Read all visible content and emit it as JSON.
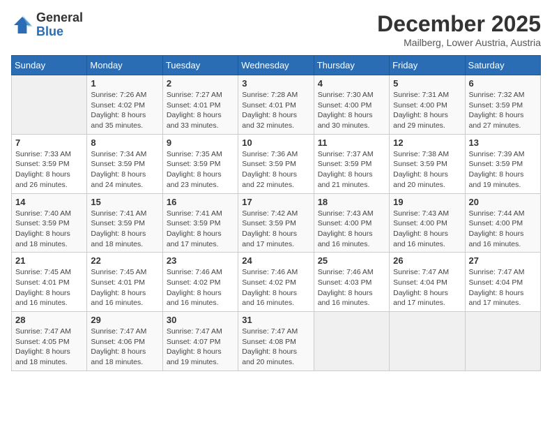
{
  "header": {
    "logo_general": "General",
    "logo_blue": "Blue",
    "month_title": "December 2025",
    "location": "Mailberg, Lower Austria, Austria"
  },
  "weekdays": [
    "Sunday",
    "Monday",
    "Tuesday",
    "Wednesday",
    "Thursday",
    "Friday",
    "Saturday"
  ],
  "weeks": [
    [
      {
        "day": "",
        "sunrise": "",
        "sunset": "",
        "daylight": ""
      },
      {
        "day": "1",
        "sunrise": "Sunrise: 7:26 AM",
        "sunset": "Sunset: 4:02 PM",
        "daylight": "Daylight: 8 hours and 35 minutes."
      },
      {
        "day": "2",
        "sunrise": "Sunrise: 7:27 AM",
        "sunset": "Sunset: 4:01 PM",
        "daylight": "Daylight: 8 hours and 33 minutes."
      },
      {
        "day": "3",
        "sunrise": "Sunrise: 7:28 AM",
        "sunset": "Sunset: 4:01 PM",
        "daylight": "Daylight: 8 hours and 32 minutes."
      },
      {
        "day": "4",
        "sunrise": "Sunrise: 7:30 AM",
        "sunset": "Sunset: 4:00 PM",
        "daylight": "Daylight: 8 hours and 30 minutes."
      },
      {
        "day": "5",
        "sunrise": "Sunrise: 7:31 AM",
        "sunset": "Sunset: 4:00 PM",
        "daylight": "Daylight: 8 hours and 29 minutes."
      },
      {
        "day": "6",
        "sunrise": "Sunrise: 7:32 AM",
        "sunset": "Sunset: 3:59 PM",
        "daylight": "Daylight: 8 hours and 27 minutes."
      }
    ],
    [
      {
        "day": "7",
        "sunrise": "Sunrise: 7:33 AM",
        "sunset": "Sunset: 3:59 PM",
        "daylight": "Daylight: 8 hours and 26 minutes."
      },
      {
        "day": "8",
        "sunrise": "Sunrise: 7:34 AM",
        "sunset": "Sunset: 3:59 PM",
        "daylight": "Daylight: 8 hours and 24 minutes."
      },
      {
        "day": "9",
        "sunrise": "Sunrise: 7:35 AM",
        "sunset": "Sunset: 3:59 PM",
        "daylight": "Daylight: 8 hours and 23 minutes."
      },
      {
        "day": "10",
        "sunrise": "Sunrise: 7:36 AM",
        "sunset": "Sunset: 3:59 PM",
        "daylight": "Daylight: 8 hours and 22 minutes."
      },
      {
        "day": "11",
        "sunrise": "Sunrise: 7:37 AM",
        "sunset": "Sunset: 3:59 PM",
        "daylight": "Daylight: 8 hours and 21 minutes."
      },
      {
        "day": "12",
        "sunrise": "Sunrise: 7:38 AM",
        "sunset": "Sunset: 3:59 PM",
        "daylight": "Daylight: 8 hours and 20 minutes."
      },
      {
        "day": "13",
        "sunrise": "Sunrise: 7:39 AM",
        "sunset": "Sunset: 3:59 PM",
        "daylight": "Daylight: 8 hours and 19 minutes."
      }
    ],
    [
      {
        "day": "14",
        "sunrise": "Sunrise: 7:40 AM",
        "sunset": "Sunset: 3:59 PM",
        "daylight": "Daylight: 8 hours and 18 minutes."
      },
      {
        "day": "15",
        "sunrise": "Sunrise: 7:41 AM",
        "sunset": "Sunset: 3:59 PM",
        "daylight": "Daylight: 8 hours and 18 minutes."
      },
      {
        "day": "16",
        "sunrise": "Sunrise: 7:41 AM",
        "sunset": "Sunset: 3:59 PM",
        "daylight": "Daylight: 8 hours and 17 minutes."
      },
      {
        "day": "17",
        "sunrise": "Sunrise: 7:42 AM",
        "sunset": "Sunset: 3:59 PM",
        "daylight": "Daylight: 8 hours and 17 minutes."
      },
      {
        "day": "18",
        "sunrise": "Sunrise: 7:43 AM",
        "sunset": "Sunset: 4:00 PM",
        "daylight": "Daylight: 8 hours and 16 minutes."
      },
      {
        "day": "19",
        "sunrise": "Sunrise: 7:43 AM",
        "sunset": "Sunset: 4:00 PM",
        "daylight": "Daylight: 8 hours and 16 minutes."
      },
      {
        "day": "20",
        "sunrise": "Sunrise: 7:44 AM",
        "sunset": "Sunset: 4:00 PM",
        "daylight": "Daylight: 8 hours and 16 minutes."
      }
    ],
    [
      {
        "day": "21",
        "sunrise": "Sunrise: 7:45 AM",
        "sunset": "Sunset: 4:01 PM",
        "daylight": "Daylight: 8 hours and 16 minutes."
      },
      {
        "day": "22",
        "sunrise": "Sunrise: 7:45 AM",
        "sunset": "Sunset: 4:01 PM",
        "daylight": "Daylight: 8 hours and 16 minutes."
      },
      {
        "day": "23",
        "sunrise": "Sunrise: 7:46 AM",
        "sunset": "Sunset: 4:02 PM",
        "daylight": "Daylight: 8 hours and 16 minutes."
      },
      {
        "day": "24",
        "sunrise": "Sunrise: 7:46 AM",
        "sunset": "Sunset: 4:02 PM",
        "daylight": "Daylight: 8 hours and 16 minutes."
      },
      {
        "day": "25",
        "sunrise": "Sunrise: 7:46 AM",
        "sunset": "Sunset: 4:03 PM",
        "daylight": "Daylight: 8 hours and 16 minutes."
      },
      {
        "day": "26",
        "sunrise": "Sunrise: 7:47 AM",
        "sunset": "Sunset: 4:04 PM",
        "daylight": "Daylight: 8 hours and 17 minutes."
      },
      {
        "day": "27",
        "sunrise": "Sunrise: 7:47 AM",
        "sunset": "Sunset: 4:04 PM",
        "daylight": "Daylight: 8 hours and 17 minutes."
      }
    ],
    [
      {
        "day": "28",
        "sunrise": "Sunrise: 7:47 AM",
        "sunset": "Sunset: 4:05 PM",
        "daylight": "Daylight: 8 hours and 18 minutes."
      },
      {
        "day": "29",
        "sunrise": "Sunrise: 7:47 AM",
        "sunset": "Sunset: 4:06 PM",
        "daylight": "Daylight: 8 hours and 18 minutes."
      },
      {
        "day": "30",
        "sunrise": "Sunrise: 7:47 AM",
        "sunset": "Sunset: 4:07 PM",
        "daylight": "Daylight: 8 hours and 19 minutes."
      },
      {
        "day": "31",
        "sunrise": "Sunrise: 7:47 AM",
        "sunset": "Sunset: 4:08 PM",
        "daylight": "Daylight: 8 hours and 20 minutes."
      },
      {
        "day": "",
        "sunrise": "",
        "sunset": "",
        "daylight": ""
      },
      {
        "day": "",
        "sunrise": "",
        "sunset": "",
        "daylight": ""
      },
      {
        "day": "",
        "sunrise": "",
        "sunset": "",
        "daylight": ""
      }
    ]
  ]
}
